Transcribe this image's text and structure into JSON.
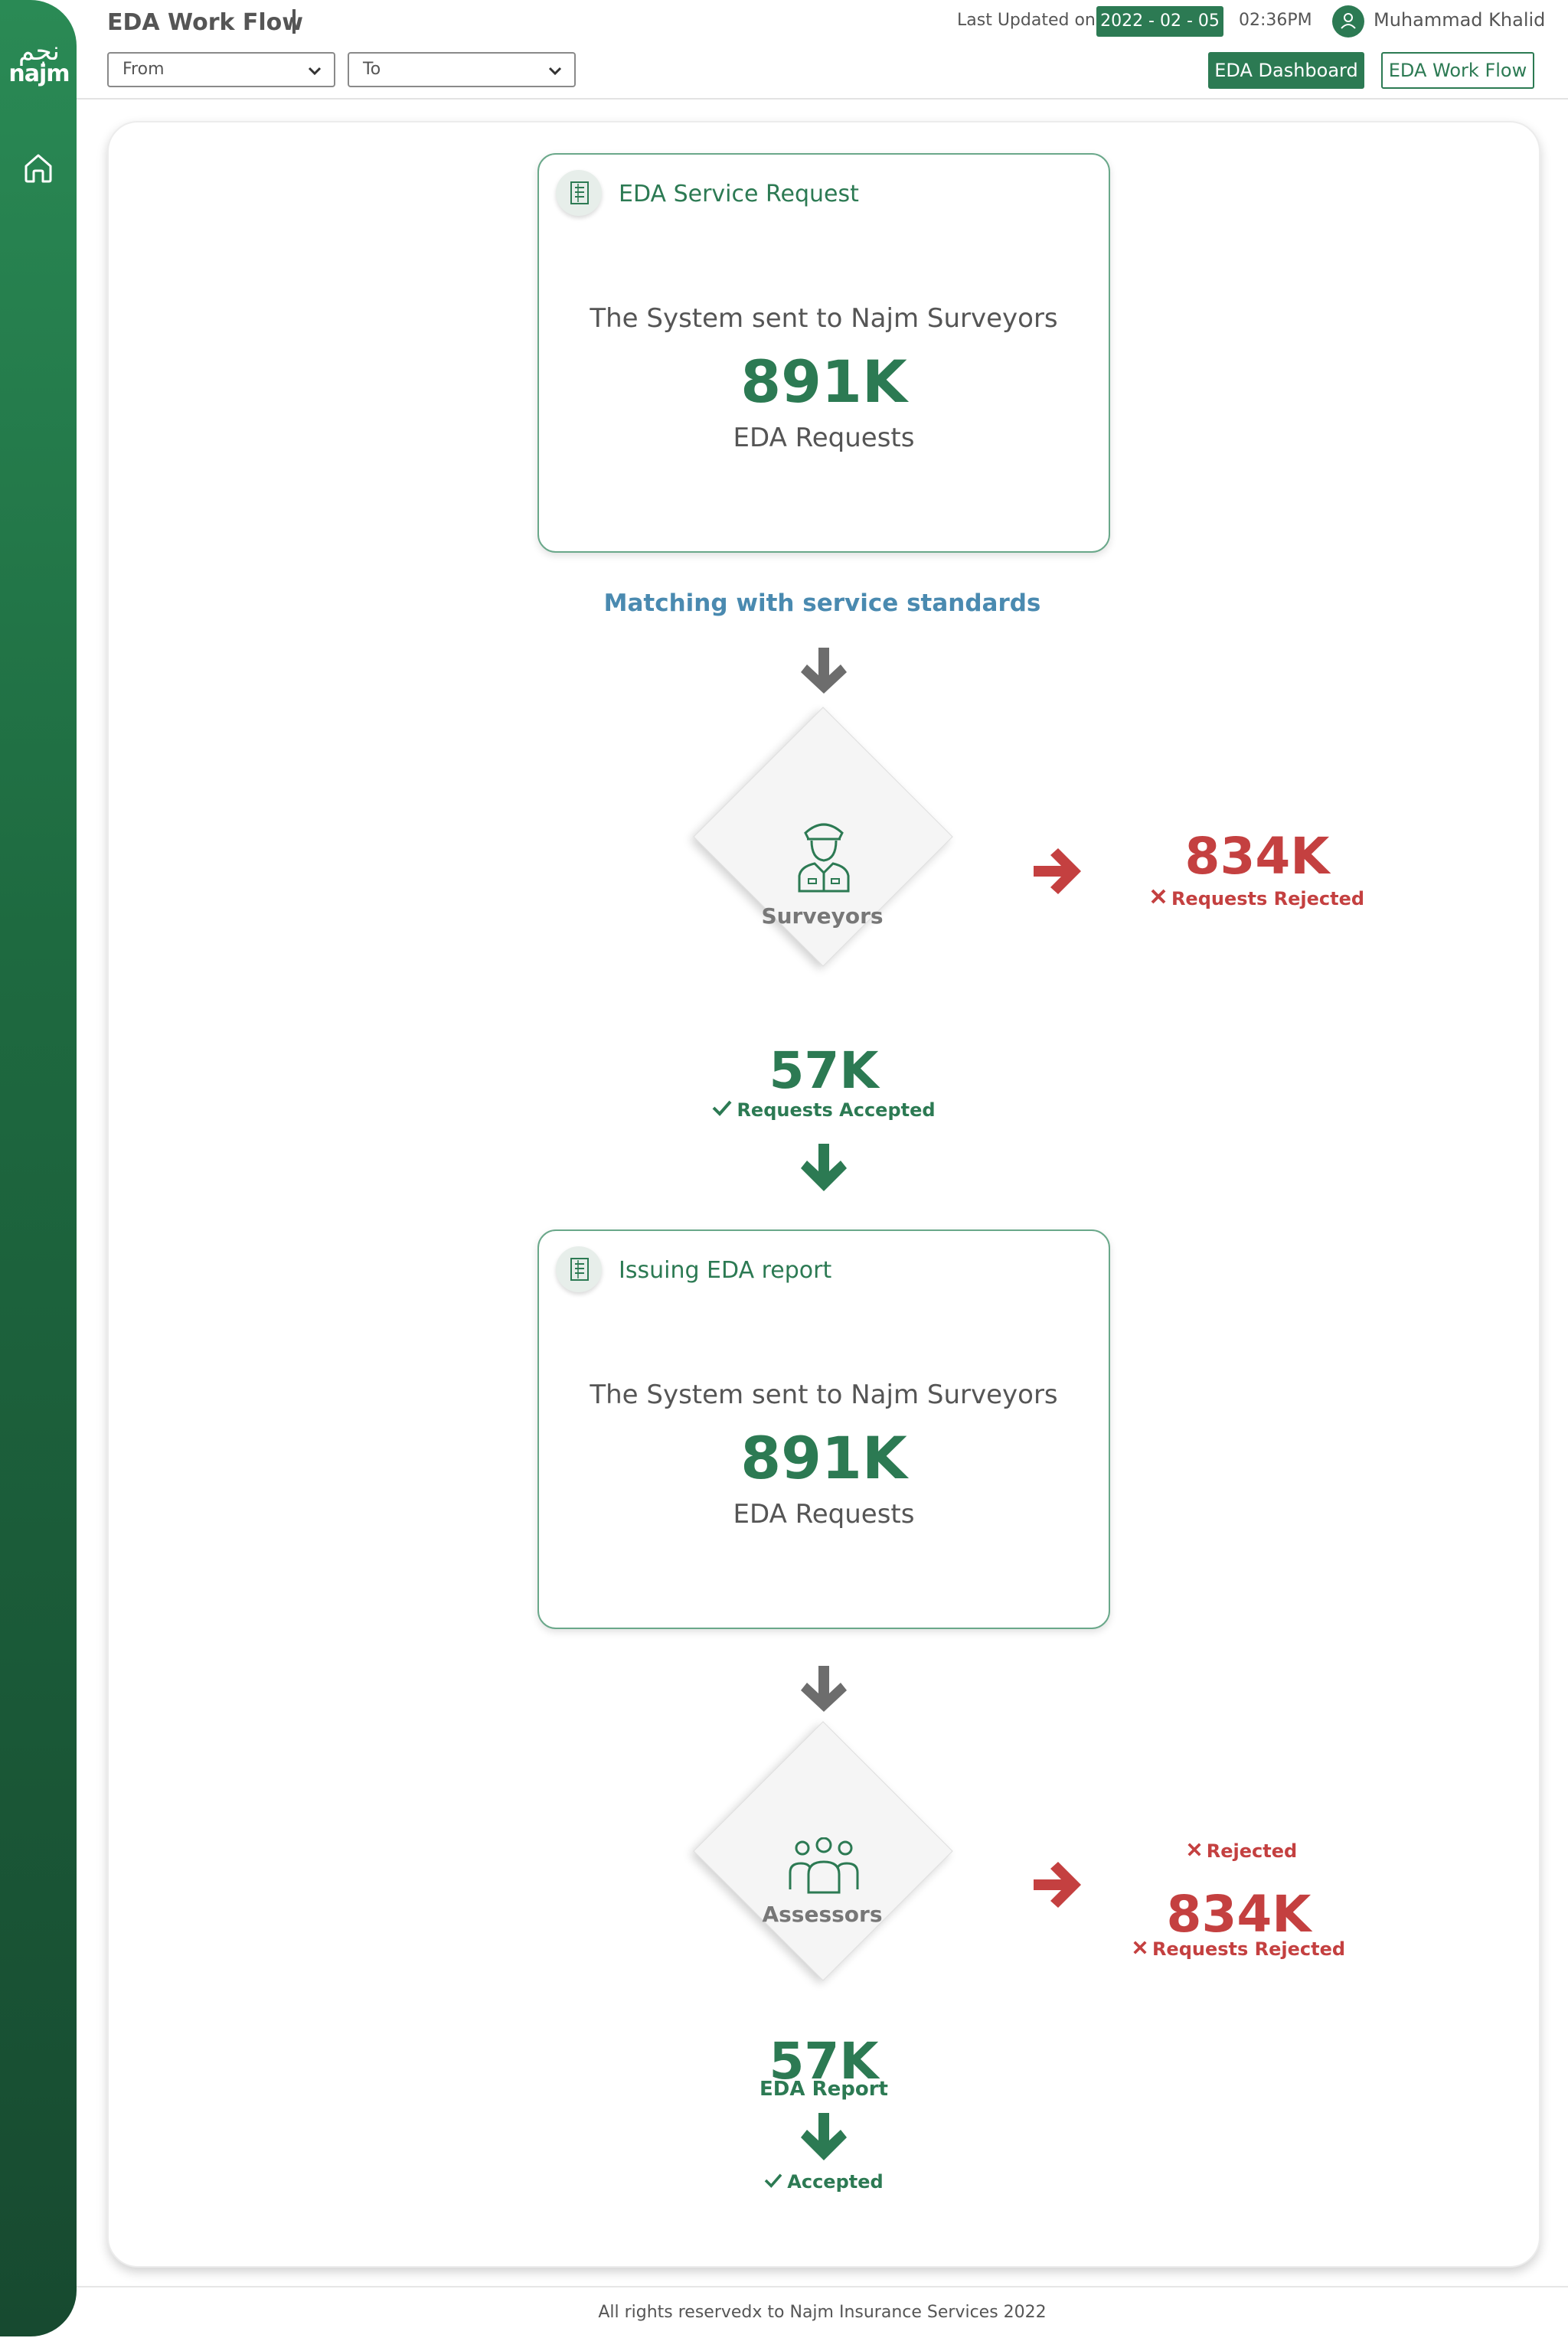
{
  "app": {
    "logo_arabic": "نجم",
    "logo_latin": "najm"
  },
  "header": {
    "title": "EDA Work Flow",
    "from_select": "From",
    "to_select": "To",
    "last_updated_label": "Last Updated on",
    "date": "2022 - 02 - 05",
    "time": "02:36PM",
    "user_name": "Muhammad Khalid",
    "dashboard_button": "EDA Dashboard",
    "workflow_button": "EDA Work Flow"
  },
  "flow": {
    "service_request": {
      "title": "EDA Service Request",
      "subtitle": "The System sent to Najm Surveyors",
      "value": "891K",
      "unit": "EDA Requests"
    },
    "matching_text": "Matching with service standards",
    "surveyors": {
      "label": "Surveyors",
      "rejected_value": "834K",
      "rejected_label": "Requests Rejected",
      "accepted_value": "57K",
      "accepted_label": "Requests Accepted"
    },
    "issuing_report": {
      "title": "Issuing EDA report",
      "subtitle": "The System sent to Najm Surveyors",
      "value": "891K",
      "unit": "EDA Requests"
    },
    "assessors": {
      "label": "Assessors",
      "rejected_header": "Rejected",
      "rejected_value": "834K",
      "rejected_label": "Requests Rejected",
      "report_value": "57K",
      "report_label": "EDA Report",
      "accepted_label": "Accepted"
    }
  },
  "colors": {
    "brand_green": "#2c7a53",
    "reject_red": "#c44040",
    "neutral_gray": "#777777",
    "link_blue": "#4a8ab0"
  },
  "footer": {
    "text": "All rights reservedx to Najm Insurance Services 2022"
  }
}
